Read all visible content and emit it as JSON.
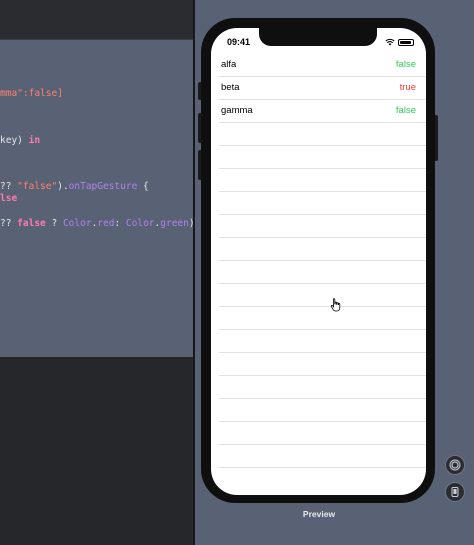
{
  "code_lines": [
    {
      "parts": [
        {
          "t": "mma\":false]",
          "c": "c-str"
        }
      ]
    },
    {
      "parts": [
        {
          "t": "key) ",
          "c": ""
        },
        {
          "t": "in",
          "c": "c-kw"
        }
      ]
    },
    {
      "parts": [
        {
          "t": "?? ",
          "c": ""
        },
        {
          "t": "\"false\"",
          "c": "c-str"
        },
        {
          "t": ").",
          "c": ""
        },
        {
          "t": "onTapGesture",
          "c": "c-purple"
        },
        {
          "t": " {",
          "c": ""
        }
      ]
    },
    {
      "parts": [
        {
          "t": "lse",
          "c": "c-kw"
        }
      ]
    },
    {
      "parts": [
        {
          "t": "?? ",
          "c": ""
        },
        {
          "t": "false",
          "c": "c-kw"
        },
        {
          "t": " ? ",
          "c": ""
        },
        {
          "t": "Color",
          "c": "c-purple"
        },
        {
          "t": ".",
          "c": ""
        },
        {
          "t": "red",
          "c": "c-purple"
        },
        {
          "t": ": ",
          "c": ""
        },
        {
          "t": "Color",
          "c": "c-purple"
        },
        {
          "t": ".",
          "c": ""
        },
        {
          "t": "green",
          "c": "c-purple"
        },
        {
          "t": ")",
          "c": ""
        }
      ]
    }
  ],
  "status_bar": {
    "time": "09:41"
  },
  "list": {
    "rows": [
      {
        "key": "alfa",
        "value": "false",
        "color": "#34c759"
      },
      {
        "key": "beta",
        "value": "true",
        "color": "#ff3b30"
      },
      {
        "key": "gamma",
        "value": "false",
        "color": "#34c759"
      }
    ]
  },
  "preview_label": "Preview",
  "icons": {
    "controls": [
      "live-preview-icon",
      "inspect-preview-icon"
    ],
    "cursor": "hand-pointer-icon"
  }
}
